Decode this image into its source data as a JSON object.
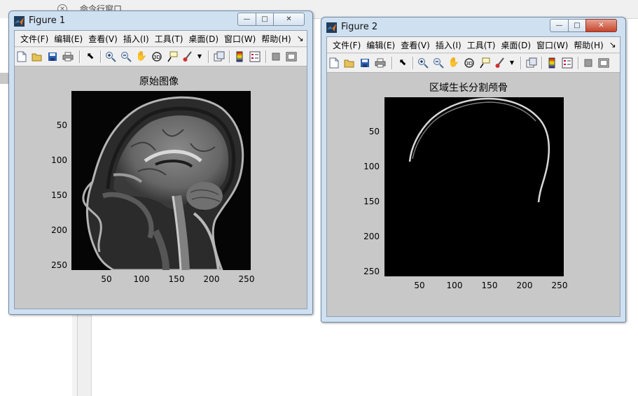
{
  "desktop": {
    "command_window_label": "命令行窗口"
  },
  "menu": [
    "文件(F)",
    "编辑(E)",
    "查看(V)",
    "插入(I)",
    "工具(T)",
    "桌面(D)",
    "窗口(W)",
    "帮助(H)"
  ],
  "menu_overflow": "↘",
  "figure1": {
    "title": "Figure 1",
    "plot_title": "原始图像",
    "image": "grayscale sagittal MRI of the head",
    "y_ticks": [
      "50",
      "100",
      "150",
      "200",
      "250"
    ],
    "x_ticks": [
      "50",
      "100",
      "150",
      "200",
      "250"
    ]
  },
  "figure2": {
    "title": "Figure 2",
    "plot_title": "区域生长分割颅骨",
    "image": "binary mask showing the segmented skull outline",
    "y_ticks": [
      "50",
      "100",
      "150",
      "200",
      "250"
    ],
    "x_ticks": [
      "50",
      "100",
      "150",
      "200",
      "250"
    ]
  },
  "window_buttons": {
    "minimize": "—",
    "maximize": "□",
    "close": "✕"
  },
  "colors": {
    "title_bar": "#cfe0f1",
    "figure_bg": "#c8c8c8",
    "close_active": "#c4452c"
  }
}
